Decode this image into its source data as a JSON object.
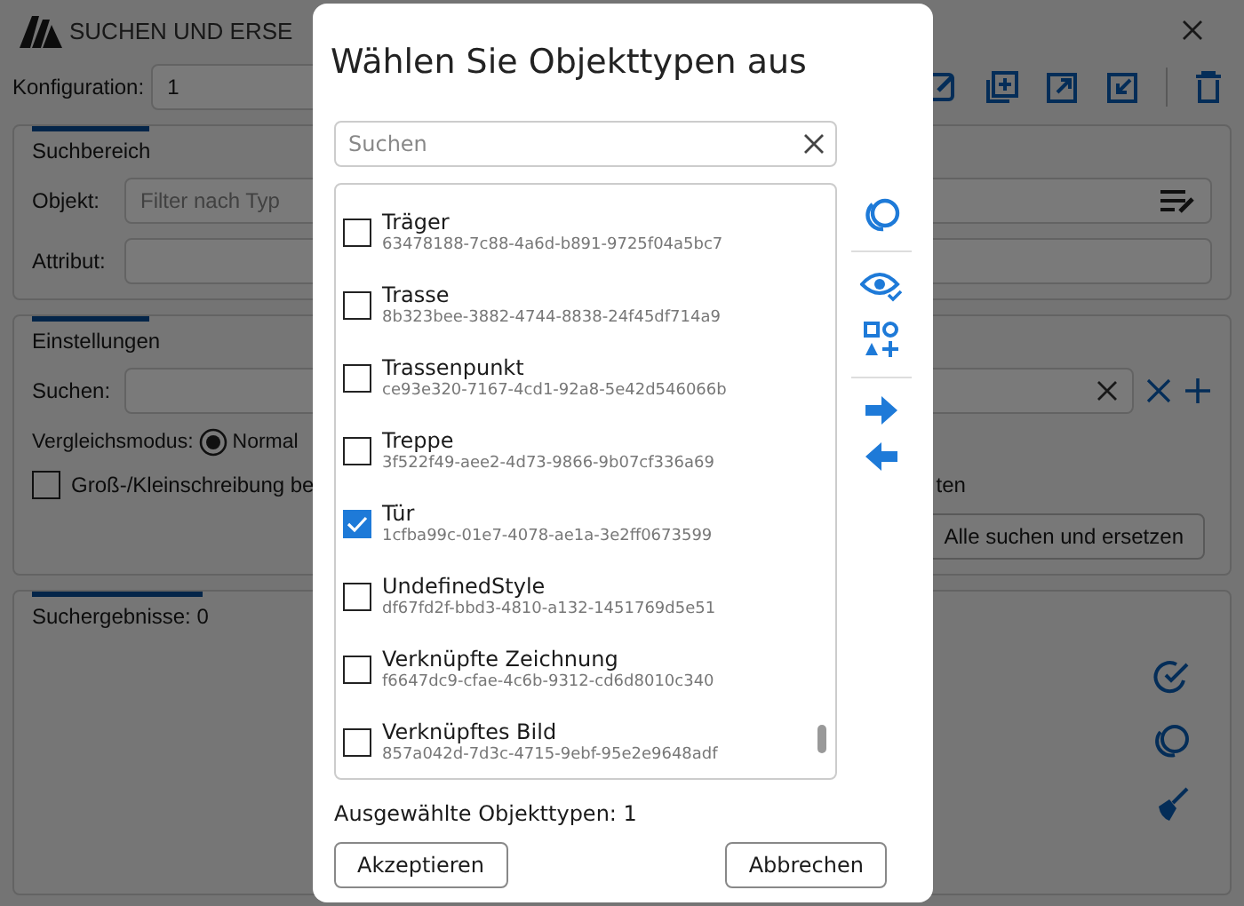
{
  "app": {
    "title": "SUCHEN UND ERSE",
    "config_label": "Konfiguration:",
    "config_value": "1",
    "search_area": {
      "heading": "Suchbereich",
      "object_label": "Objekt:",
      "object_placeholder": "Filter nach Typ",
      "attribute_label": "Attribut:"
    },
    "settings": {
      "heading": "Einstellungen",
      "search_label": "Suchen:",
      "mode_label": "Vergleichsmodus:",
      "mode_option": "Normal",
      "mode_selected": true,
      "case_label": "Groß-/Kleinschreibung be",
      "case_checked": false,
      "right_fragment": "ten",
      "replace_all_button": "Alle suchen und ersetzen"
    },
    "results": {
      "heading": "Suchergebnisse: 0"
    }
  },
  "dialog": {
    "title": "Wählen Sie Objekttypen aus",
    "search_placeholder": "Suchen",
    "items": [
      {
        "name": "Träger",
        "id": "63478188-7c88-4a6d-b891-9725f04a5bc7",
        "checked": false
      },
      {
        "name": "Trasse",
        "id": "8b323bee-3882-4744-8838-24f45df714a9",
        "checked": false
      },
      {
        "name": "Trassenpunkt",
        "id": "ce93e320-7167-4cd1-92a8-5e42d546066b",
        "checked": false
      },
      {
        "name": "Treppe",
        "id": "3f522f49-aee2-4d73-9866-9b07cf336a69",
        "checked": false
      },
      {
        "name": "Tür",
        "id": "1cfba99c-01e7-4078-ae1a-3e2ff0673599",
        "checked": true
      },
      {
        "name": "UndefinedStyle",
        "id": "df67fd2f-bbd3-4810-a132-1451769d5e51",
        "checked": false
      },
      {
        "name": "Verknüpfte Zeichnung",
        "id": "f6647dc9-cfae-4c6b-9312-cd6d8010c340",
        "checked": false
      },
      {
        "name": "Verknüpftes Bild",
        "id": "857a042d-7d3c-4715-9ebf-95e2e9648adf",
        "checked": false
      }
    ],
    "selected_count": "Ausgewählte Objekttypen: 1",
    "accept_button": "Akzeptieren",
    "cancel_button": "Abbrechen"
  }
}
